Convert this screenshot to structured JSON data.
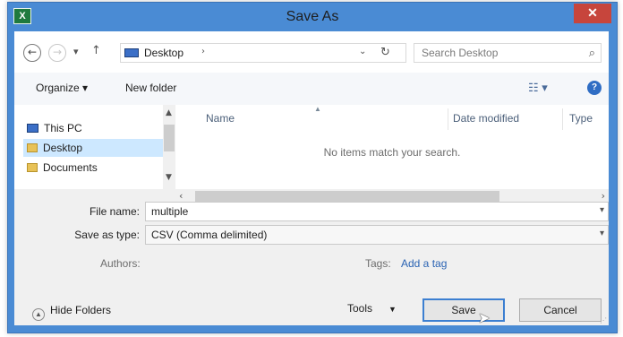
{
  "window": {
    "title": "Save As",
    "app_icon_label": "X",
    "close_label": "✕",
    "accent": "#4a8bd4"
  },
  "address_bar": {
    "back_icon": "back-arrow-icon",
    "forward_icon": "forward-arrow-icon",
    "recent_icon": "chevron-down-icon",
    "up_icon": "up-arrow-icon",
    "location": "Desktop",
    "separator": "›",
    "dropdown_glyph": "⌄",
    "refresh_glyph": "↻",
    "search_placeholder": "Search Desktop",
    "search_glyph": "⌕"
  },
  "toolbar": {
    "organize_label": "Organize ▾",
    "new_folder_label": "New folder",
    "view_glyph": "☷ ▾",
    "help_glyph": "?"
  },
  "nav_pane": {
    "items": [
      {
        "label": "This PC",
        "icon": "computer-icon"
      },
      {
        "label": "Desktop",
        "icon": "folder-icon",
        "selected": true
      },
      {
        "label": "Documents",
        "icon": "folder-icon"
      }
    ]
  },
  "file_pane": {
    "columns": [
      "Name",
      "Date modified",
      "Type"
    ],
    "empty_message": "No items match your search."
  },
  "form": {
    "file_name_label": "File name:",
    "file_name_value": "multiple",
    "save_type_label": "Save as type:",
    "save_type_value": "CSV (Comma delimited)",
    "authors_label": "Authors:",
    "tags_label": "Tags:",
    "add_tag_link": "Add a tag"
  },
  "footer": {
    "hide_folders_label": "Hide Folders",
    "tools_label": "Tools",
    "save_label": "Save",
    "cancel_label": "Cancel"
  }
}
